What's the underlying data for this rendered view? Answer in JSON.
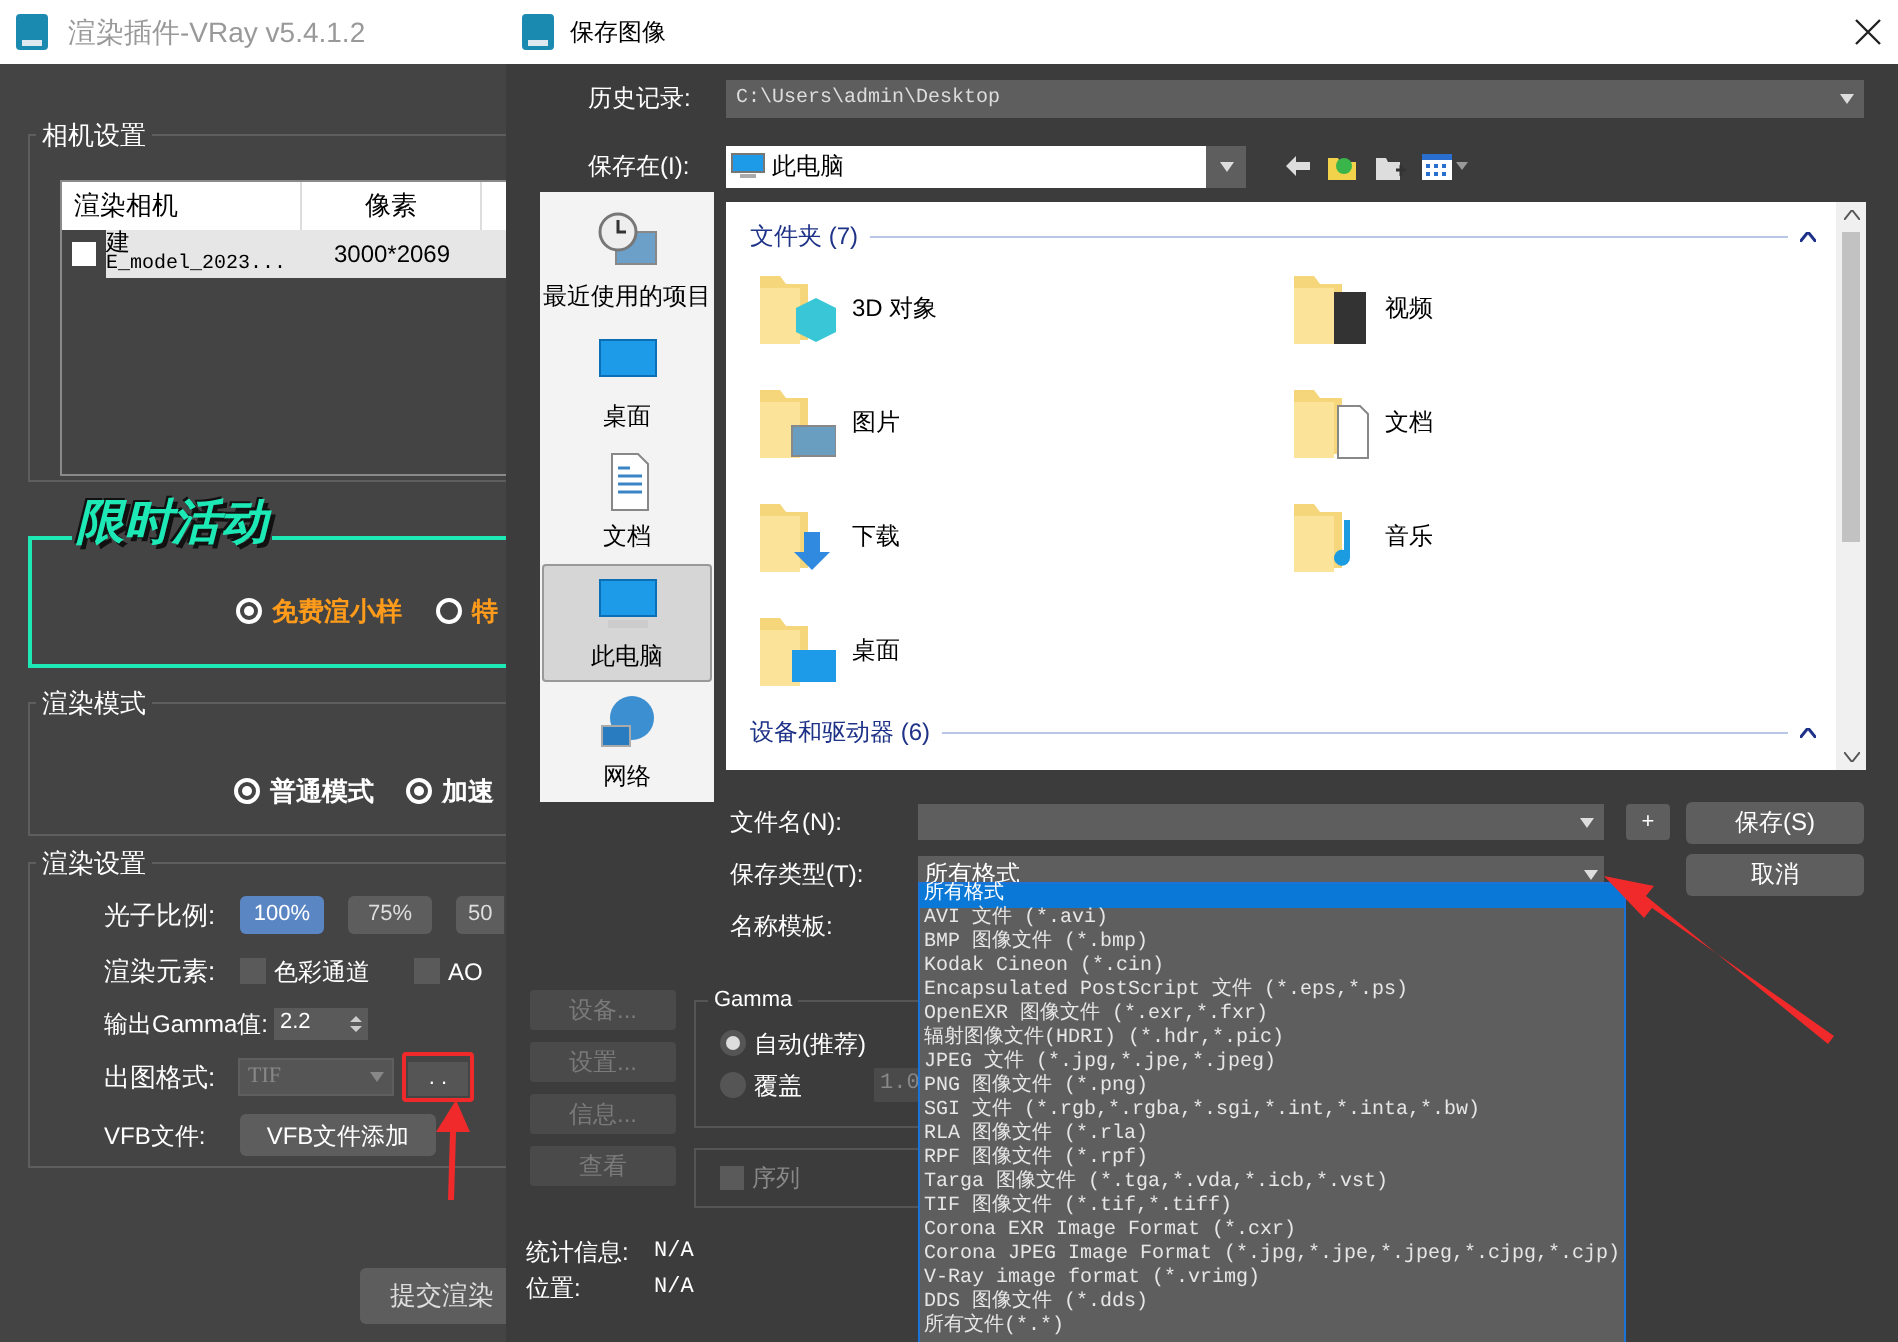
{
  "main_window": {
    "title": "渲染插件-VRay v5.4.1.2",
    "camera_settings": {
      "title": "相机设置",
      "columns": [
        "渲染相机",
        "像素"
      ],
      "rows": [
        {
          "checked": false,
          "name_line_1": "建",
          "name_line_2": "E_model_2023...",
          "pixels": "3000*2069"
        }
      ]
    },
    "promo": {
      "title": "限时活动",
      "options": [
        {
          "label": "免费渲小样",
          "selected": true
        },
        {
          "label": "特",
          "selected": false
        }
      ]
    },
    "render_mode": {
      "title": "渲染模式",
      "options": [
        {
          "label": "普通模式",
          "selected": true
        },
        {
          "label": "加速",
          "selected": true
        }
      ]
    },
    "render_settings": {
      "title": "渲染设置",
      "photon_ratio": {
        "label": "光子比例:",
        "options": [
          {
            "label": "100%",
            "selected": true
          },
          {
            "label": "75%",
            "selected": false
          },
          {
            "label": "50",
            "selected": false
          }
        ]
      },
      "render_elements": {
        "label": "渲染元素:",
        "options": [
          {
            "label": "色彩通道",
            "checked": false
          },
          {
            "label": "AO",
            "checked": false
          }
        ]
      },
      "gamma": {
        "label": "输出Gamma值:",
        "value": "2.2"
      },
      "format": {
        "label": "出图格式:",
        "value": "TIF",
        "disabled": true,
        "button": ". ."
      },
      "vfb": {
        "label": "VFB文件:",
        "button": "VFB文件添加"
      }
    },
    "submit_button": "提交渲染"
  },
  "dialog": {
    "title": "保存图像",
    "history": {
      "label": "历史记录:",
      "value": "C:\\Users\\admin\\Desktop"
    },
    "save_in": {
      "label": "保存在(I):",
      "value": "此电脑"
    },
    "places": [
      {
        "label": "最近使用的项目",
        "selected": false
      },
      {
        "label": "桌面",
        "selected": false
      },
      {
        "label": "文档",
        "selected": false
      },
      {
        "label": "此电脑",
        "selected": true
      },
      {
        "label": "网络",
        "selected": false
      }
    ],
    "groups": [
      {
        "title": "文件夹 (7)",
        "items": [
          "3D 对象",
          "视频",
          "图片",
          "文档",
          "下载",
          "音乐",
          "桌面"
        ]
      },
      {
        "title": "设备和驱动器 (6)"
      }
    ],
    "file_name": {
      "label": "文件名(N):"
    },
    "add_button": "+",
    "save_button": "保存(S)",
    "cancel_button": "取消",
    "save_type": {
      "label": "保存类型(T):",
      "value": "所有格式",
      "options": [
        {
          "label": "所有格式",
          "selected": true
        },
        {
          "label": "AVI 文件 (*.avi)",
          "selected": false
        },
        {
          "label": "BMP 图像文件 (*.bmp)",
          "selected": false
        },
        {
          "label": "Kodak Cineon (*.cin)",
          "selected": false
        },
        {
          "label": "Encapsulated PostScript 文件 (*.eps,*.ps)",
          "selected": false
        },
        {
          "label": "OpenEXR 图像文件 (*.exr,*.fxr)",
          "selected": false
        },
        {
          "label": "辐射图像文件(HDRI) (*.hdr,*.pic)",
          "selected": false
        },
        {
          "label": "JPEG 文件 (*.jpg,*.jpe,*.jpeg)",
          "selected": false
        },
        {
          "label": "PNG 图像文件 (*.png)",
          "selected": false
        },
        {
          "label": "SGI 文件 (*.rgb,*.rgba,*.sgi,*.int,*.inta,*.bw)",
          "selected": false
        },
        {
          "label": "RLA 图像文件 (*.rla)",
          "selected": false
        },
        {
          "label": "RPF 图像文件 (*.rpf)",
          "selected": false
        },
        {
          "label": "Targa 图像文件 (*.tga,*.vda,*.icb,*.vst)",
          "selected": false
        },
        {
          "label": "TIF 图像文件 (*.tif,*.tiff)",
          "selected": false
        },
        {
          "label": "Corona EXR Image Format (*.cxr)",
          "selected": false
        },
        {
          "label": "Corona JPEG Image Format (*.jpg,*.jpe,*.jpeg,*.cjpg,*.cjp)",
          "selected": false
        },
        {
          "label": "V-Ray image format (*.vrimg)",
          "selected": false
        },
        {
          "label": "DDS 图像文件 (*.dds)",
          "selected": false
        },
        {
          "label": "所有文件(*.*)",
          "selected": false
        }
      ]
    },
    "name_template": {
      "label": "名称模板:"
    },
    "side_buttons": [
      {
        "label": "设备...",
        "disabled": true
      },
      {
        "label": "设置...",
        "disabled": true
      },
      {
        "label": "信息...",
        "disabled": true
      },
      {
        "label": "查看",
        "disabled": true
      }
    ],
    "gamma": {
      "title": "Gamma",
      "options": [
        {
          "label": "自动(推荐)",
          "selected": true
        },
        {
          "label": "覆盖",
          "selected": false
        }
      ],
      "override_value": "1.0"
    },
    "sequence": {
      "label": "序列",
      "checked": false
    },
    "stats": [
      {
        "label": "统计信息:",
        "value": "N/A"
      },
      {
        "label": "位置:",
        "value": "N/A"
      }
    ]
  }
}
